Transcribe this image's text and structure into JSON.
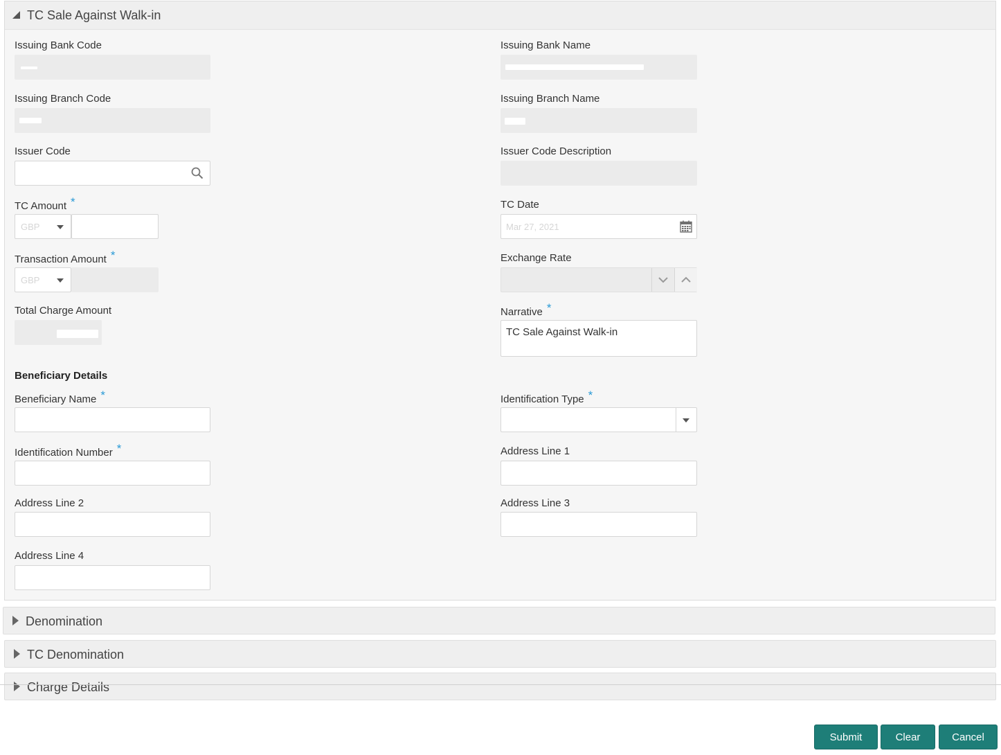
{
  "panel": {
    "title": "TC Sale Against Walk-in",
    "fields": {
      "issuing_bank_code": "Issuing Bank Code",
      "issuing_bank_name": "Issuing Bank Name",
      "issuing_branch_code": "Issuing Branch Code",
      "issuing_branch_name": "Issuing Branch Name",
      "issuer_code": "Issuer Code",
      "issuer_code_description": "Issuer Code Description",
      "tc_amount": "TC Amount",
      "tc_date": "TC Date",
      "transaction_amount": "Transaction Amount",
      "exchange_rate": "Exchange Rate",
      "total_charge_amount": "Total Charge Amount",
      "narrative": "Narrative"
    },
    "values": {
      "tc_amount_currency": "GBP",
      "transaction_amount_currency": "GBP",
      "tc_date": "Mar 27, 2021",
      "narrative": "TC Sale Against Walk-in"
    },
    "required_mark": "*",
    "beneficiary": {
      "title": "Beneficiary Details",
      "beneficiary_name": "Beneficiary Name",
      "identification_type": "Identification Type",
      "identification_number": "Identification Number",
      "address_line_1": "Address Line 1",
      "address_line_2": "Address Line 2",
      "address_line_3": "Address Line 3",
      "address_line_4": "Address Line 4"
    }
  },
  "accordions": {
    "denomination": "Denomination",
    "tc_denomination": "TC Denomination",
    "charge_details": "Charge Details"
  },
  "buttons": {
    "submit": "Submit",
    "clear": "Clear",
    "cancel": "Cancel"
  },
  "colors": {
    "button": "#1e7e78",
    "required": "#2a9ad6",
    "panel_bg": "#f6f6f6",
    "readonly_bg": "#ebebeb"
  },
  "icons": {
    "issuer_lookup": "search-icon",
    "tc_date_picker": "calendar-icon",
    "exchange_rate_down": "chevron-down-icon",
    "exchange_rate_up": "chevron-up-icon",
    "panel_toggle": "triangle-down-icon",
    "accordion_toggle": "triangle-right-icon"
  }
}
